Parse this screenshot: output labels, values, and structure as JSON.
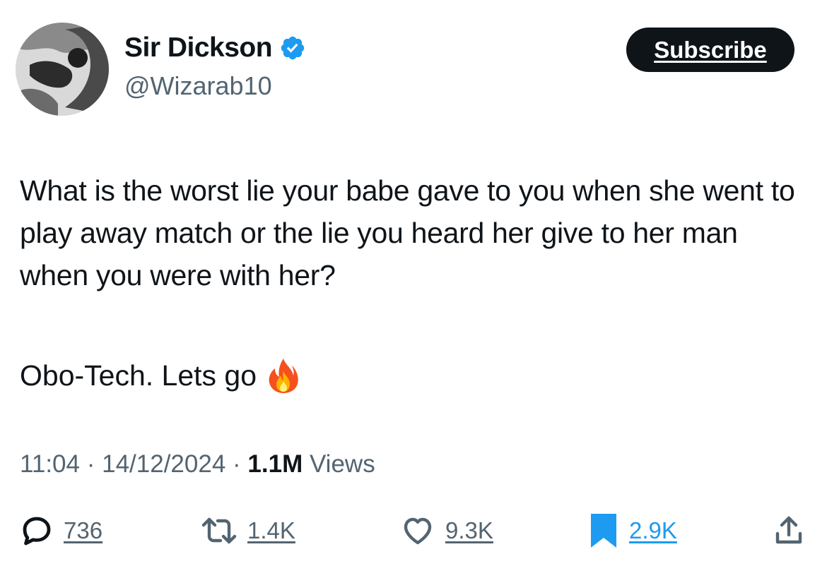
{
  "author": {
    "display_name": "Sir Dickson",
    "handle": "@Wizarab10",
    "verified_icon": "verified-badge-icon",
    "verified_color": "#1d9bf0"
  },
  "subscribe": {
    "label": "Subscribe"
  },
  "tweet": {
    "paragraph1": "What is the worst lie your babe gave to you when she went to play away match or the lie you heard her give to her man when you were with her?",
    "paragraph2": "Obo-Tech. Lets go",
    "emoji": "fire-icon"
  },
  "meta": {
    "time": "11:04",
    "separator": "·",
    "date": "14/12/2024",
    "views_count": "1.1M",
    "views_label": "Views"
  },
  "actions": {
    "replies": "736",
    "reposts": "1.4K",
    "likes": "9.3K",
    "bookmarks": "2.9K"
  },
  "colors": {
    "text": "#0f1419",
    "secondary": "#536471",
    "accent": "#1d9bf0"
  }
}
